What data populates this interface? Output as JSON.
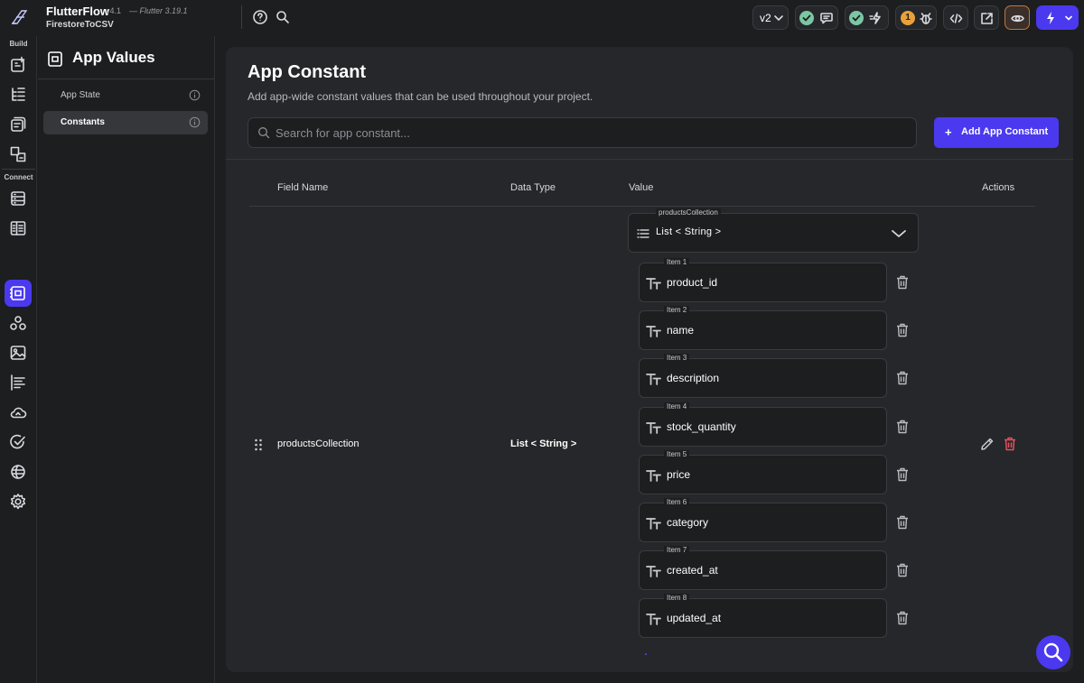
{
  "header": {
    "app_name": "FlutterFlow",
    "app_version": "v4.1",
    "flutter_version": "— Flutter 3.19.1",
    "project_name": "FirestoreToCSV",
    "branch_version": "v2",
    "issues_count": "1"
  },
  "rail": {
    "build_label": "Build",
    "connect_label": "Connect",
    "items": [
      "widget-palette",
      "layers",
      "storyboard",
      "theme",
      "firestore",
      "api-calls",
      "app-values",
      "custom-code",
      "media-assets",
      "cloud-functions",
      "cloud",
      "agent",
      "integrations",
      "settings"
    ]
  },
  "panel": {
    "title": "App Values",
    "items": [
      {
        "label": "App State",
        "active": false
      },
      {
        "label": "Constants",
        "active": true
      }
    ]
  },
  "main": {
    "title": "App Constant",
    "description": "Add app-wide constant values that can be used throughout your project.",
    "search_placeholder": "Search for app constant...",
    "add_button": "Add App Constant",
    "add_icon": "+",
    "columns": {
      "field_name": "Field Name",
      "data_type": "Data Type",
      "value": "Value",
      "actions": "Actions"
    },
    "row": {
      "field_name": "productsCollection",
      "data_type": "List < String >",
      "value_label": "productsCollection",
      "value_type": "List < String >",
      "items": [
        {
          "label": "Item 1",
          "value": "product_id"
        },
        {
          "label": "Item 2",
          "value": "name"
        },
        {
          "label": "Item 3",
          "value": "description"
        },
        {
          "label": "Item 4",
          "value": "stock_quantity"
        },
        {
          "label": "Item 5",
          "value": "price"
        },
        {
          "label": "Item 6",
          "value": "category"
        },
        {
          "label": "Item 7",
          "value": "created_at"
        },
        {
          "label": "Item 8",
          "value": "updated_at"
        }
      ]
    }
  },
  "colors": {
    "accent": "#4b39ef",
    "background": "#1d1e20",
    "surface": "#26272a",
    "success": "#7cc6a4",
    "warning": "#e8a13a",
    "danger": "#e0515e"
  }
}
